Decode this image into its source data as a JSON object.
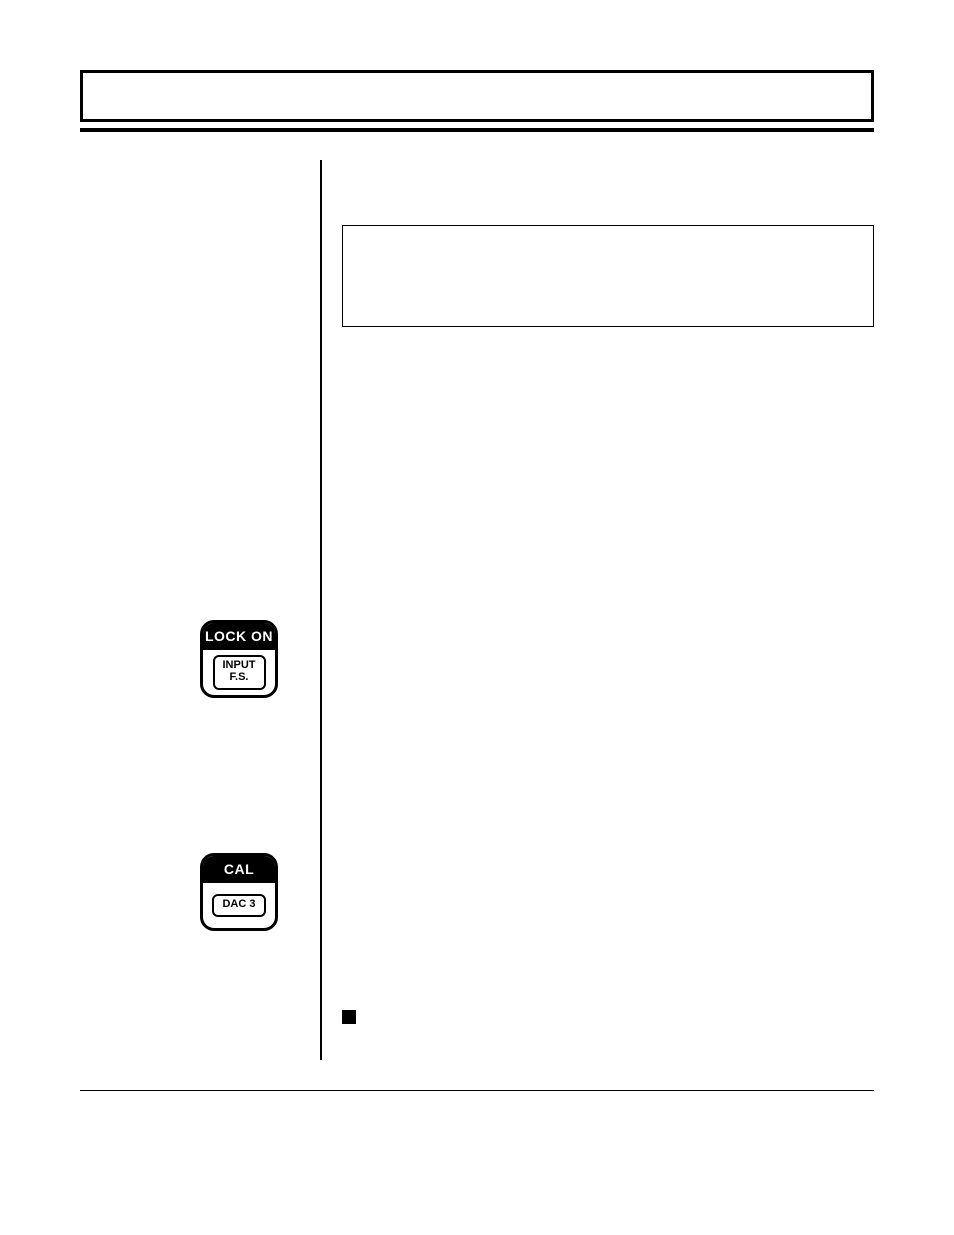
{
  "title_bar": {
    "text": ""
  },
  "callout": {
    "text": ""
  },
  "left_column": {
    "keys": [
      {
        "id": "lock-on-key",
        "top_label": "LOCK ON",
        "bottom_label": "INPUT\nF.S."
      },
      {
        "id": "cal-key",
        "top_label": "CAL",
        "bottom_label": "DAC 3"
      }
    ]
  },
  "right_column": {
    "bullet_glyph": "■"
  },
  "footer": {
    "text": ""
  }
}
